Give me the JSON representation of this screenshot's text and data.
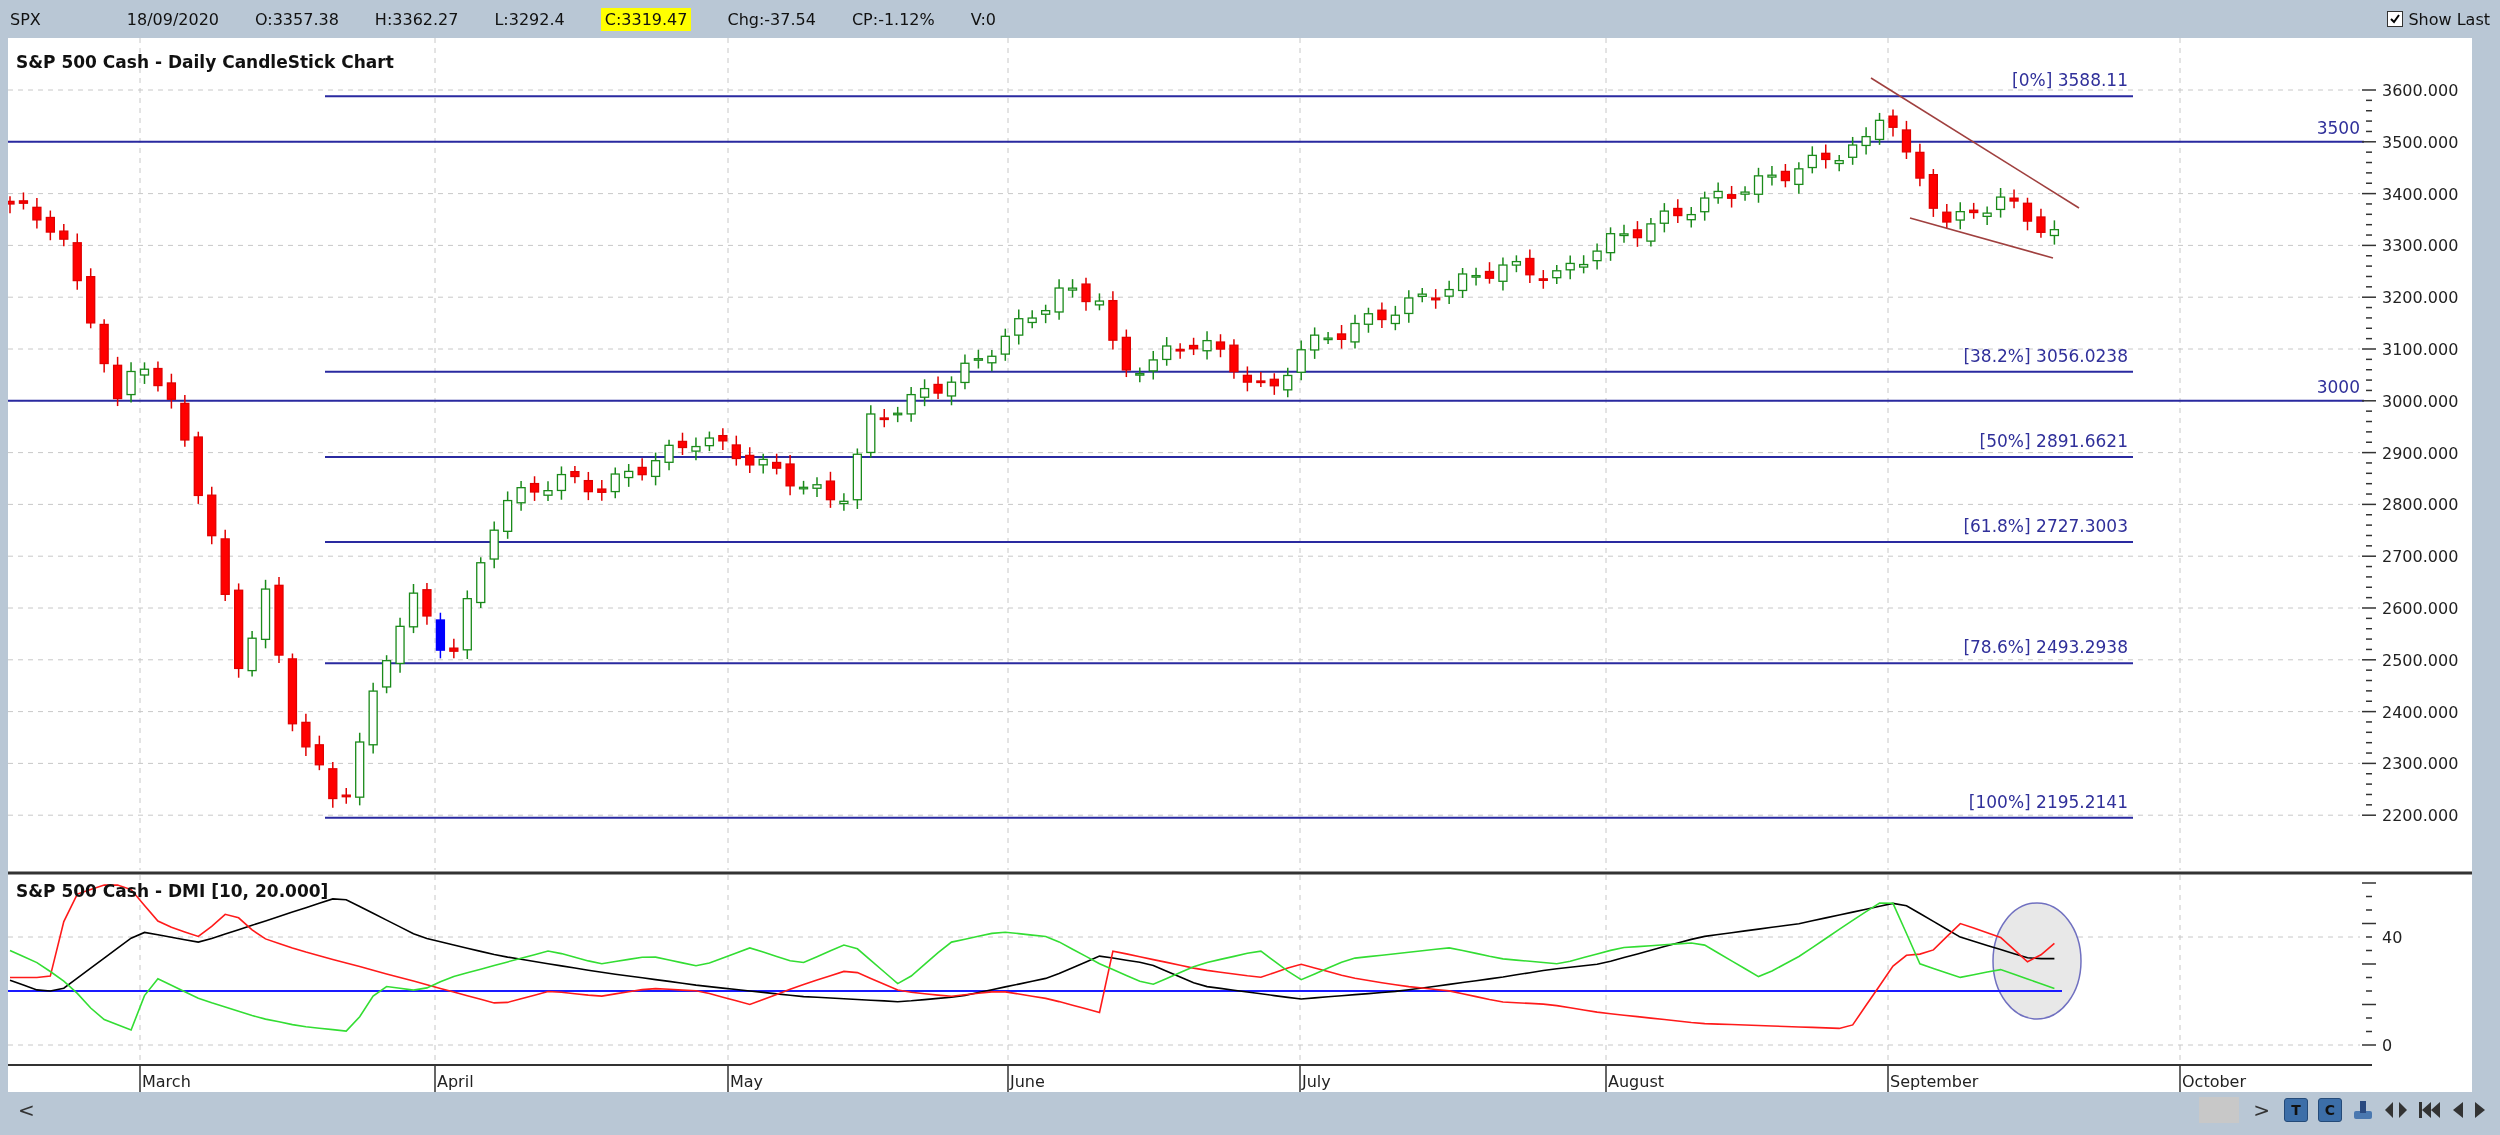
{
  "quote_bar": {
    "symbol": "SPX",
    "date": "18/09/2020",
    "open": "O:3357.38",
    "high": "H:3362.27",
    "low": "L:3292.4",
    "close": "C:3319.47",
    "change": "Chg:-37.54",
    "change_percent": "CP:-1.12%",
    "volume": "V:0",
    "show_last": {
      "label": "Show Last",
      "checked": true
    }
  },
  "price_chart": {
    "title": "S&P 500 Cash - Daily CandleStick Chart",
    "axis_labels": [
      "3600.000",
      "3500.000",
      "3400.000",
      "3300.000",
      "3200.000",
      "3100.000",
      "3000.000",
      "2900.000",
      "2800.000",
      "2700.000",
      "2600.000",
      "2500.000",
      "2400.000",
      "2300.000",
      "2200.000"
    ],
    "fibonacci_levels": [
      "[0%] 3588.11",
      "[38.2%] 3056.0238",
      "[50%] 2891.6621",
      "[61.8%] 2727.3003",
      "[78.6%] 2493.2938",
      "[100%] 2195.2141"
    ],
    "horizontal_lines": [
      "3500",
      "3000"
    ]
  },
  "dmi_chart": {
    "title": "S&P 500 Cash - DMI [10, 20.000]",
    "axis_labels": [
      "40",
      "0"
    ]
  },
  "months": [
    "March",
    "April",
    "May",
    "June",
    "July",
    "August",
    "September",
    "October"
  ],
  "scroll_bar": {
    "left_arrow": "<",
    "right_arrow": ">"
  },
  "toolbar_icons": [
    {
      "kind": "letter",
      "label": "T"
    },
    {
      "kind": "letter",
      "label": "C"
    },
    {
      "kind": "pin"
    },
    {
      "kind": "fit"
    },
    {
      "kind": "first"
    },
    {
      "kind": "prev"
    },
    {
      "kind": "next"
    }
  ]
}
